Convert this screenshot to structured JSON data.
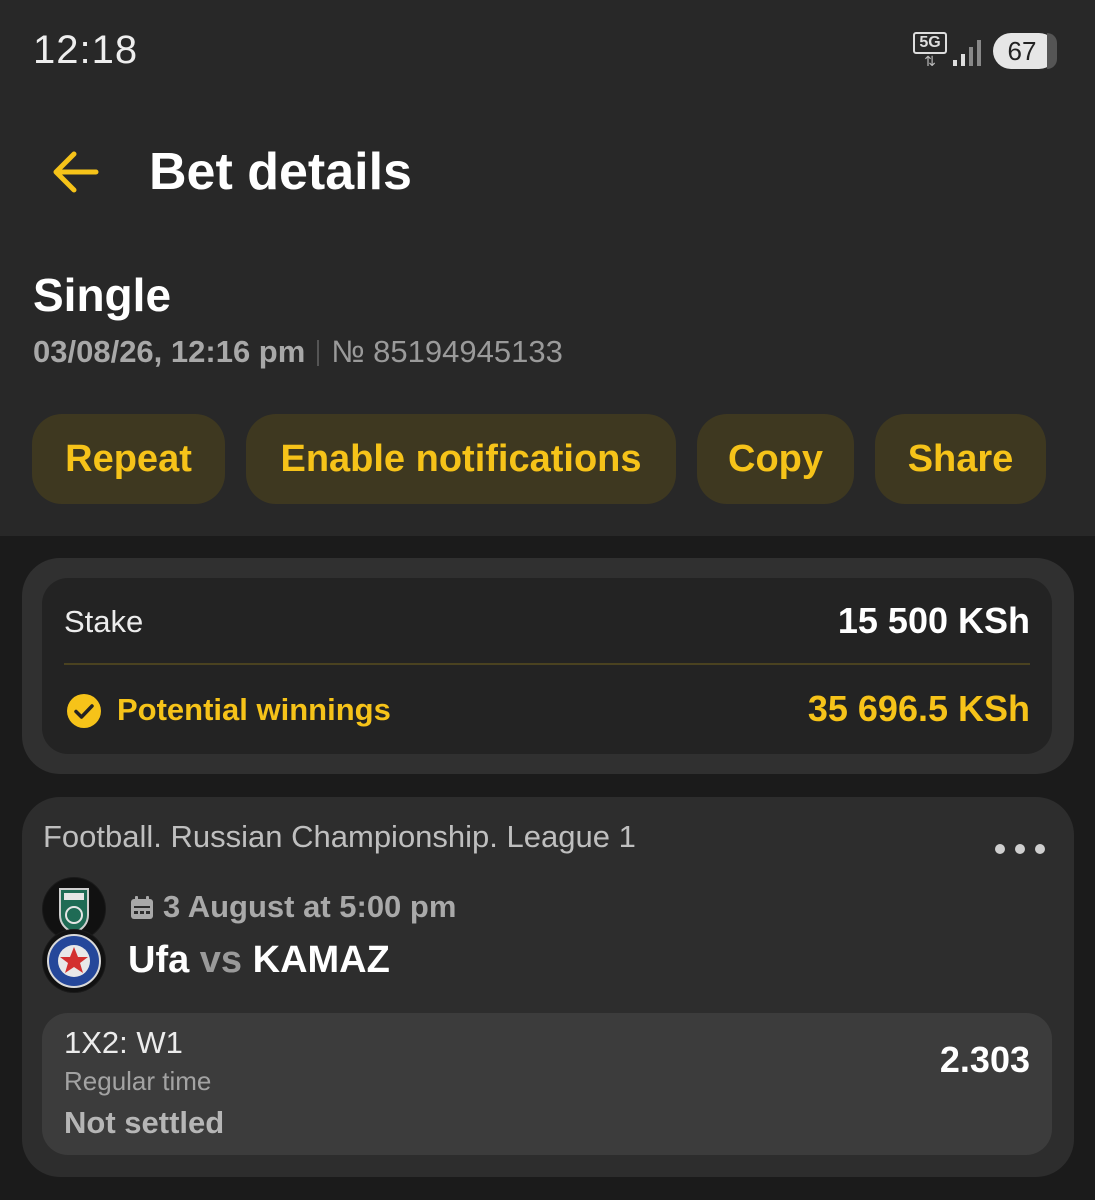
{
  "status_bar": {
    "time": "12:18",
    "network": "5G",
    "battery": "67"
  },
  "header": {
    "title": "Bet details",
    "back_icon": "arrow-left-icon"
  },
  "bet": {
    "type": "Single",
    "datetime": "03/08/26, 12:16 pm",
    "number": "№ 85194945133"
  },
  "actions": [
    {
      "label": "Repeat"
    },
    {
      "label": "Enable notifications"
    },
    {
      "label": "Copy"
    },
    {
      "label": "Share"
    }
  ],
  "summary": {
    "stake_label": "Stake",
    "stake_value": "15 500 KSh",
    "winnings_label": "Potential winnings",
    "winnings_value": "35 696.5 KSh",
    "winnings_icon": "check-circle-icon"
  },
  "event": {
    "league": "Football. Russian Championship. League 1",
    "date": "3 August at 5:00 pm",
    "home": "Ufa",
    "vs": "vs",
    "away": "KAMAZ",
    "more_icon": "more-horizontal-icon"
  },
  "selection": {
    "market": "1X2: W1",
    "period": "Regular time",
    "status": "Not settled",
    "odds": "2.303"
  },
  "colors": {
    "accent": "#f6c319",
    "pill_bg": "#3e3820",
    "top_bg": "#282828",
    "body_bg": "#1b1b1b"
  }
}
